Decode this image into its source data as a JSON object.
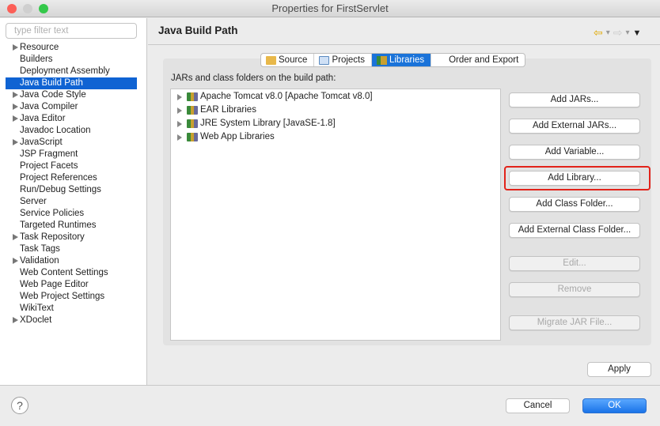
{
  "window": {
    "title": "Properties for FirstServlet"
  },
  "sidebar": {
    "filter_placeholder": "type filter text",
    "selected": "Java Build Path",
    "items": [
      {
        "label": "Resource",
        "expandable": true
      },
      {
        "label": "Builders",
        "expandable": false
      },
      {
        "label": "Deployment Assembly",
        "expandable": false
      },
      {
        "label": "Java Build Path",
        "expandable": false
      },
      {
        "label": "Java Code Style",
        "expandable": true
      },
      {
        "label": "Java Compiler",
        "expandable": true
      },
      {
        "label": "Java Editor",
        "expandable": true
      },
      {
        "label": "Javadoc Location",
        "expandable": false
      },
      {
        "label": "JavaScript",
        "expandable": true
      },
      {
        "label": "JSP Fragment",
        "expandable": false
      },
      {
        "label": "Project Facets",
        "expandable": false
      },
      {
        "label": "Project References",
        "expandable": false
      },
      {
        "label": "Run/Debug Settings",
        "expandable": false
      },
      {
        "label": "Server",
        "expandable": false
      },
      {
        "label": "Service Policies",
        "expandable": false
      },
      {
        "label": "Targeted Runtimes",
        "expandable": false
      },
      {
        "label": "Task Repository",
        "expandable": true
      },
      {
        "label": "Task Tags",
        "expandable": false
      },
      {
        "label": "Validation",
        "expandable": true
      },
      {
        "label": "Web Content Settings",
        "expandable": false
      },
      {
        "label": "Web Page Editor",
        "expandable": false
      },
      {
        "label": "Web Project Settings",
        "expandable": false
      },
      {
        "label": "WikiText",
        "expandable": false
      },
      {
        "label": "XDoclet",
        "expandable": true
      }
    ]
  },
  "header": {
    "title": "Java Build Path",
    "nav_icons": [
      "back-arrow-icon",
      "forward-arrow-icon",
      "menu-dropdown-icon"
    ]
  },
  "tabs": [
    {
      "label": "Source",
      "icon": "source-folder-icon"
    },
    {
      "label": "Projects",
      "icon": "folder-icon"
    },
    {
      "label": "Libraries",
      "icon": "library-icon",
      "active": true
    },
    {
      "label": "Order and Export",
      "icon": "order-export-icon"
    }
  ],
  "main": {
    "list_label": "JARs and class folders on the build path:",
    "libraries": [
      "Apache Tomcat v8.0 [Apache Tomcat v8.0]",
      "EAR Libraries",
      "JRE System Library [JavaSE-1.8]",
      "Web App Libraries"
    ],
    "buttons": [
      {
        "label": "Add JARs...",
        "enabled": true
      },
      {
        "label": "Add External JARs...",
        "enabled": true
      },
      {
        "label": "Add Variable...",
        "enabled": true
      },
      {
        "label": "Add Library...",
        "enabled": true,
        "highlighted": true
      },
      {
        "label": "Add Class Folder...",
        "enabled": true
      },
      {
        "label": "Add External Class Folder...",
        "enabled": true
      },
      {
        "label": "Edit...",
        "enabled": false
      },
      {
        "label": "Remove",
        "enabled": false
      },
      {
        "label": "Migrate JAR File...",
        "enabled": false
      }
    ],
    "apply_label": "Apply"
  },
  "footer": {
    "help": "?",
    "cancel_label": "Cancel",
    "ok_label": "OK"
  },
  "colors": {
    "accent": "#1a73d9",
    "highlight": "#e2231a"
  }
}
